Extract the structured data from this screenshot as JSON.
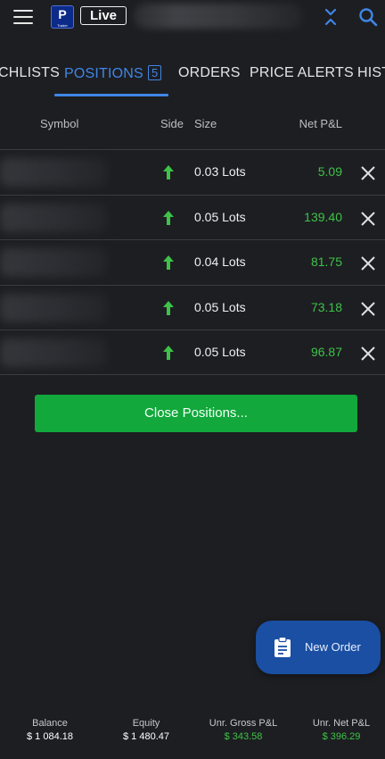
{
  "header": {
    "logo_letter": "P",
    "logo_subtext": "Trader",
    "mode_label": "Live"
  },
  "tabs": [
    {
      "label": "CHLISTS"
    },
    {
      "label": "POSITIONS",
      "count": "5"
    },
    {
      "label": "ORDERS"
    },
    {
      "label": "PRICE ALERTS"
    },
    {
      "label": "HIST"
    }
  ],
  "table": {
    "columns": {
      "symbol": "Symbol",
      "side": "Side",
      "size": "Size",
      "pnl": "Net P&L"
    },
    "rows": [
      {
        "side": "buy",
        "size": "0.03 Lots",
        "pnl": "5.09"
      },
      {
        "side": "buy",
        "size": "0.05 Lots",
        "pnl": "139.40"
      },
      {
        "side": "buy",
        "size": "0.04 Lots",
        "pnl": "81.75"
      },
      {
        "side": "buy",
        "size": "0.05 Lots",
        "pnl": "73.18"
      },
      {
        "side": "buy",
        "size": "0.05 Lots",
        "pnl": "96.87"
      }
    ]
  },
  "actions": {
    "close_positions": "Close Positions...",
    "new_order": "New Order"
  },
  "footer": [
    {
      "label": "Balance",
      "value": "$ 1 084.18",
      "color": "#ffffff"
    },
    {
      "label": "Equity",
      "value": "$ 1 480.47",
      "color": "#ffffff"
    },
    {
      "label": "Unr. Gross P&L",
      "value": "$ 343.58",
      "color": "#3ec248"
    },
    {
      "label": "Unr. Net P&L",
      "value": "$ 396.29",
      "color": "#3ec248"
    }
  ],
  "colors": {
    "background": "#1d1e22",
    "accent": "#3f86e6",
    "profit": "#3ec248",
    "button_green": "#12a83c",
    "fab_blue": "#1a4fa3"
  },
  "icons": {
    "menu": "hamburger-icon",
    "collapse": "collapse-arrows-icon",
    "search": "search-icon",
    "side": "arrow-up-icon",
    "close": "close-icon",
    "new_order": "clipboard-icon"
  }
}
